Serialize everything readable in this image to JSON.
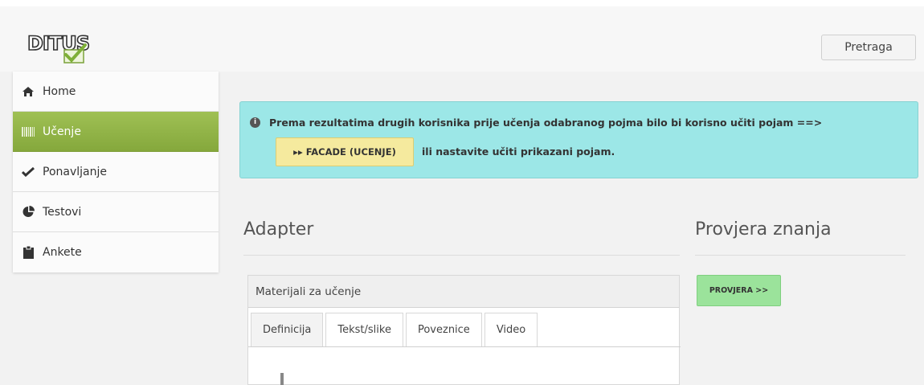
{
  "header": {
    "logo_text": "DITUS",
    "search_label": "Pretraga"
  },
  "sidebar": {
    "items": [
      {
        "label": "Home",
        "icon": "home-icon"
      },
      {
        "label": "Učenje",
        "icon": "barcode-icon",
        "active": true
      },
      {
        "label": "Ponavljanje",
        "icon": "check-icon"
      },
      {
        "label": "Testovi",
        "icon": "pie-chart-icon"
      },
      {
        "label": "Ankete",
        "icon": "clipboard-icon"
      }
    ]
  },
  "alert": {
    "message": "Prema rezultatima drugih korisnika prije učenja odabranog pojma bilo bi korisno učiti pojam ==>",
    "button_label": "FACADE (UCENJE)",
    "button_prefix": "▸▸",
    "suffix": "ili nastavite učiti prikazani pojam."
  },
  "main": {
    "title": "Adapter",
    "panel_title": "Materijali za učenje",
    "tabs": [
      "Definicija",
      "Tekst/slike",
      "Poveznice",
      "Video"
    ],
    "active_tab": 0
  },
  "side": {
    "title": "Provjera znanja",
    "button_label": "PROVJERA >>"
  },
  "colors": {
    "active_nav": "#8fb046",
    "alert_bg": "#9ce7e7",
    "facade_btn": "#f5ea9e",
    "provjera_btn": "#9be39b"
  }
}
